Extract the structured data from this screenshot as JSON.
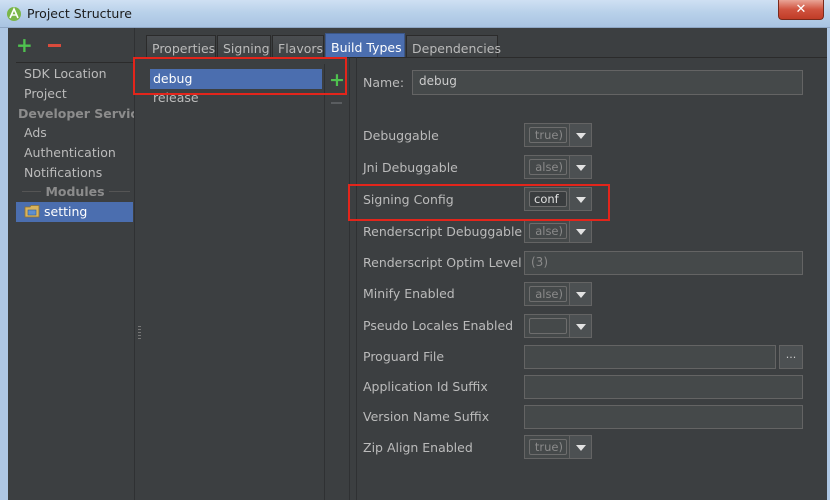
{
  "window": {
    "title": "Project Structure",
    "close_glyph": "✕"
  },
  "toolbar": {
    "add_glyph": "+"
  },
  "nav": {
    "sdk_location": "SDK Location",
    "project": "Project",
    "developer_services": "Developer Servic...",
    "ads": "Ads",
    "authentication": "Authentication",
    "notifications": "Notifications",
    "modules_header": "Modules",
    "module_setting": "setting"
  },
  "tabs": [
    "Properties",
    "Signing",
    "Flavors",
    "Build Types",
    "Dependencies"
  ],
  "build_types": {
    "items": [
      "debug",
      "release"
    ],
    "add_glyph": "+"
  },
  "form": {
    "name_label": "Name:",
    "name_value": "debug",
    "debuggable_label": "Debuggable",
    "debuggable_value": "true)",
    "jni_debuggable_label": "Jni Debuggable",
    "jni_debuggable_value": "alse)",
    "signing_config_label": "Signing Config",
    "signing_config_value": "conf",
    "renderscript_debuggable_label": "Renderscript Debuggable",
    "renderscript_debuggable_value": "alse)",
    "renderscript_optim_label": "Renderscript Optim Level",
    "renderscript_optim_value": "(3)",
    "minify_label": "Minify Enabled",
    "minify_value": "alse)",
    "pseudo_locales_label": "Pseudo Locales Enabled",
    "pseudo_locales_value": "",
    "proguard_label": "Proguard File",
    "browse_glyph": "...",
    "app_id_suffix_label": "Application Id Suffix",
    "version_name_suffix_label": "Version Name Suffix",
    "zip_align_label": "Zip Align Enabled",
    "zip_align_value": "true)"
  },
  "colors": {
    "selection": "#4b6eaf",
    "highlight_box": "#e3251b",
    "add_green": "#4fc14f",
    "remove_red": "#d94b3c"
  }
}
